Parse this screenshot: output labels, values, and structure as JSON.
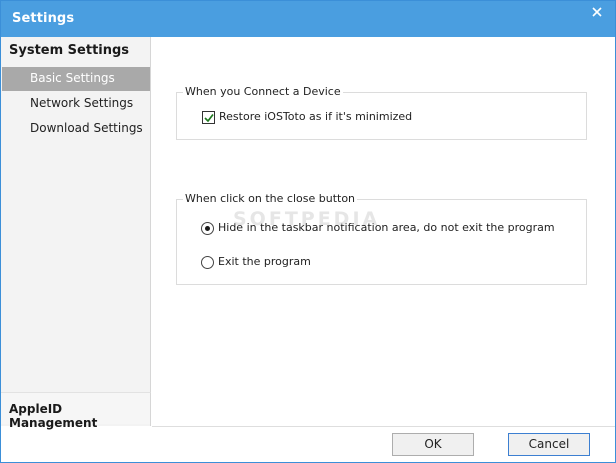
{
  "window": {
    "title": "Settings",
    "watermark": "SOFTPEDIA"
  },
  "sidebar": {
    "header": "System Settings",
    "items": [
      {
        "label": "Basic Settings",
        "active": true
      },
      {
        "label": "Network Settings",
        "active": false
      },
      {
        "label": "Download Settings",
        "active": false
      }
    ],
    "bottom_item": "AppleID Management"
  },
  "connect_group": {
    "legend": "When you Connect a Device",
    "option_label": "Restore iOSToto as if it's minimized",
    "checked": true
  },
  "close_group": {
    "legend": "When click on the close button",
    "options": [
      {
        "label": "Hide in the taskbar notification area, do not exit the program",
        "selected": true
      },
      {
        "label": "Exit the program",
        "selected": false
      }
    ]
  },
  "buttons": {
    "ok": "OK",
    "cancel": "Cancel"
  },
  "colors": {
    "titlebar": "#4a9ee0",
    "sidebar_active": "#a9a9a9",
    "sidebar_bg": "#f3f3f3"
  },
  "icons": {
    "close": "close-icon",
    "check": "checkmark-icon",
    "radio": "radio-dot-icon"
  }
}
